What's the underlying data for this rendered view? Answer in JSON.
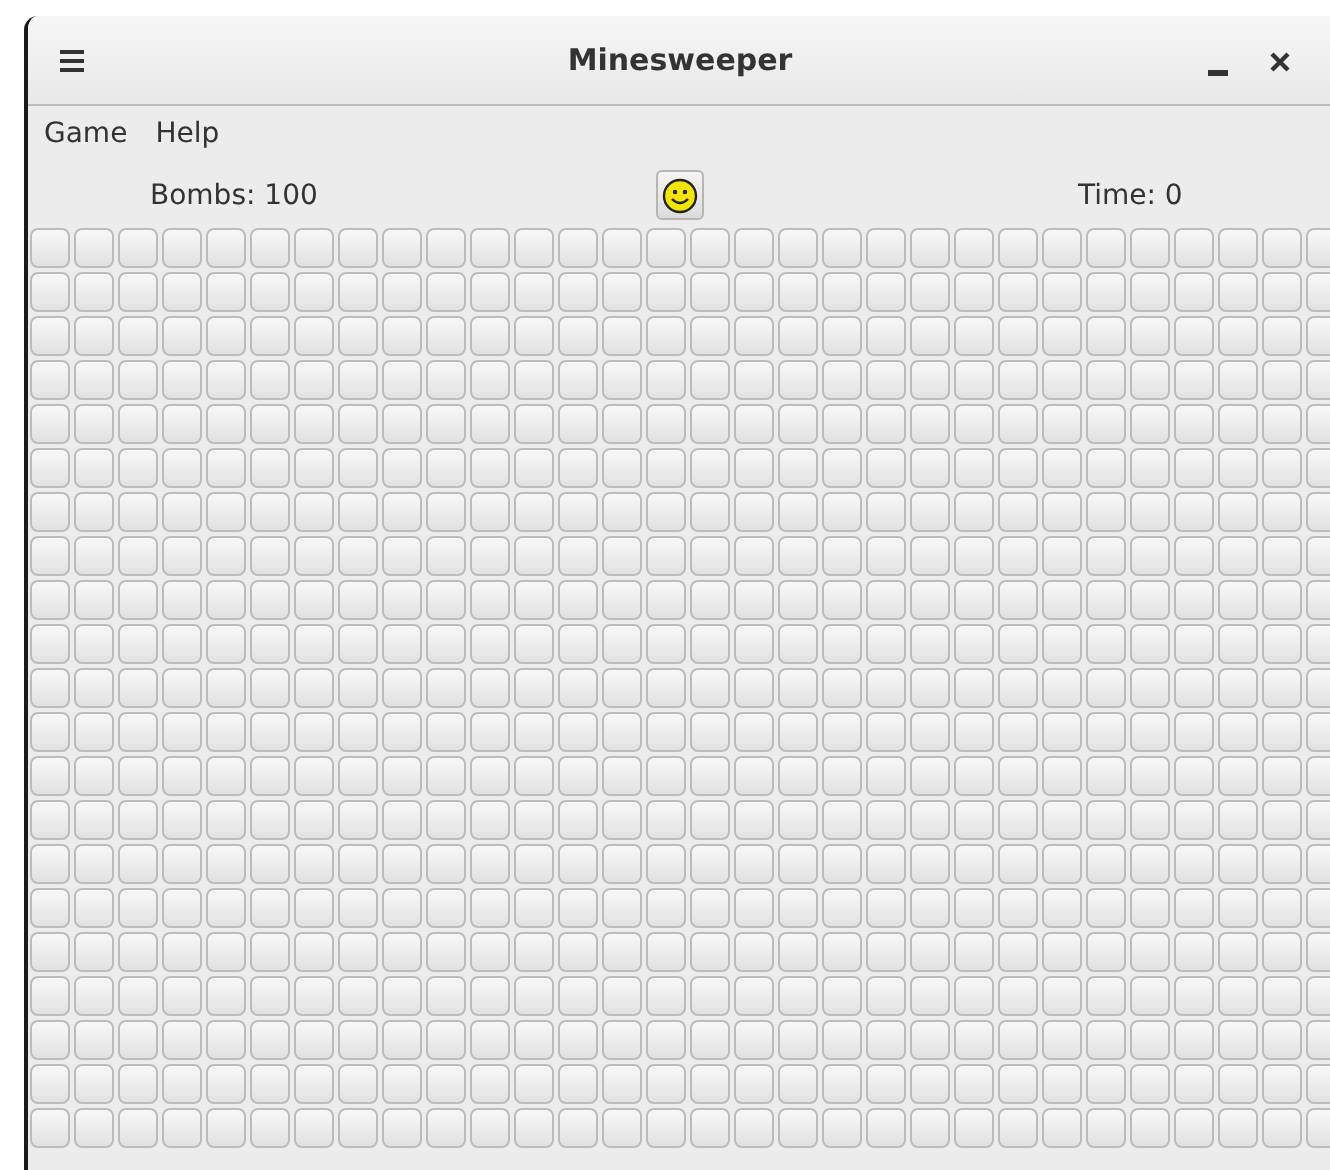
{
  "window": {
    "title": "Minesweeper"
  },
  "menu": [
    "Game",
    "Help"
  ],
  "status": {
    "bombs": "Bombs: 100",
    "time": "Time: 0"
  },
  "board": {
    "rows": [
      [
        false,
        false,
        false,
        false,
        false,
        false,
        false,
        false,
        false,
        false,
        false,
        false,
        false,
        false,
        false,
        false,
        false,
        false,
        false,
        false,
        false,
        false,
        false,
        false,
        false,
        false,
        false,
        false,
        false,
        false
      ],
      [
        false,
        false,
        false,
        false,
        false,
        false,
        false,
        false,
        false,
        false,
        false,
        false,
        false,
        false,
        false,
        false,
        false,
        false,
        false,
        false,
        false,
        false,
        false,
        false,
        false,
        false,
        false,
        false,
        false,
        false
      ],
      [
        false,
        false,
        false,
        false,
        false,
        false,
        false,
        false,
        false,
        false,
        false,
        false,
        false,
        false,
        false,
        false,
        false,
        false,
        false,
        false,
        false,
        false,
        false,
        false,
        false,
        false,
        false,
        false,
        false,
        false
      ],
      [
        false,
        false,
        false,
        false,
        false,
        false,
        false,
        false,
        false,
        false,
        false,
        false,
        false,
        false,
        false,
        false,
        false,
        false,
        false,
        false,
        false,
        false,
        false,
        false,
        false,
        false,
        false,
        false,
        false,
        false
      ],
      [
        false,
        false,
        false,
        false,
        false,
        false,
        false,
        false,
        false,
        false,
        false,
        false,
        false,
        false,
        false,
        false,
        false,
        false,
        false,
        false,
        false,
        false,
        false,
        false,
        false,
        false,
        false,
        false,
        false,
        false
      ],
      [
        false,
        false,
        false,
        false,
        false,
        false,
        false,
        false,
        false,
        false,
        false,
        false,
        false,
        false,
        false,
        false,
        false,
        false,
        false,
        false,
        false,
        false,
        false,
        false,
        false,
        false,
        false,
        false,
        false,
        false
      ],
      [
        false,
        false,
        false,
        false,
        false,
        false,
        false,
        false,
        false,
        false,
        false,
        false,
        false,
        false,
        false,
        false,
        false,
        false,
        false,
        false,
        false,
        false,
        false,
        false,
        false,
        false,
        false,
        false,
        false,
        false
      ],
      [
        false,
        false,
        false,
        false,
        false,
        false,
        false,
        false,
        false,
        false,
        false,
        false,
        false,
        false,
        false,
        false,
        false,
        false,
        false,
        false,
        false,
        false,
        false,
        false,
        false,
        false,
        false,
        false,
        false,
        false
      ],
      [
        false,
        false,
        false,
        false,
        false,
        false,
        false,
        false,
        false,
        false,
        false,
        false,
        false,
        false,
        false,
        false,
        false,
        false,
        false,
        false,
        false,
        false,
        false,
        false,
        false,
        false,
        false,
        false,
        false,
        false
      ],
      [
        false,
        false,
        false,
        false,
        false,
        false,
        false,
        false,
        false,
        false,
        false,
        false,
        false,
        false,
        false,
        false,
        false,
        false,
        false,
        false,
        false,
        false,
        false,
        false,
        false,
        false,
        false,
        false,
        false,
        false
      ],
      [
        false,
        false,
        false,
        false,
        false,
        false,
        false,
        false,
        false,
        false,
        false,
        false,
        false,
        false,
        false,
        false,
        false,
        false,
        false,
        false,
        false,
        false,
        false,
        false,
        false,
        false,
        false,
        false,
        false,
        false
      ],
      [
        false,
        false,
        false,
        false,
        false,
        false,
        false,
        false,
        false,
        false,
        false,
        false,
        false,
        false,
        false,
        false,
        false,
        false,
        false,
        false,
        false,
        false,
        false,
        false,
        false,
        false,
        false,
        false,
        false,
        false
      ],
      [
        false,
        false,
        false,
        false,
        false,
        false,
        false,
        false,
        false,
        false,
        false,
        false,
        false,
        false,
        false,
        false,
        false,
        false,
        false,
        false,
        false,
        false,
        false,
        false,
        false,
        false,
        false,
        false,
        false,
        false
      ],
      [
        false,
        false,
        false,
        false,
        false,
        false,
        false,
        false,
        false,
        false,
        false,
        false,
        false,
        false,
        false,
        false,
        false,
        false,
        false,
        false,
        false,
        false,
        false,
        false,
        false,
        false,
        false,
        false,
        false,
        false
      ],
      [
        false,
        false,
        false,
        false,
        false,
        false,
        false,
        false,
        false,
        false,
        false,
        false,
        false,
        false,
        false,
        false,
        false,
        false,
        false,
        false,
        false,
        false,
        false,
        false,
        false,
        false,
        false,
        false,
        false,
        false
      ],
      [
        false,
        false,
        false,
        false,
        false,
        false,
        false,
        false,
        false,
        false,
        false,
        false,
        false,
        false,
        false,
        false,
        false,
        false,
        false,
        false,
        false,
        false,
        false,
        false,
        false,
        false,
        false,
        false,
        false,
        false
      ],
      [
        false,
        false,
        false,
        false,
        false,
        false,
        false,
        false,
        false,
        false,
        false,
        false,
        false,
        false,
        false,
        false,
        false,
        false,
        false,
        false,
        false,
        false,
        false,
        false,
        false,
        false,
        false,
        false,
        false,
        false
      ],
      [
        false,
        false,
        false,
        false,
        false,
        false,
        false,
        false,
        false,
        false,
        false,
        false,
        false,
        false,
        false,
        false,
        false,
        false,
        false,
        false,
        false,
        false,
        false,
        false,
        false,
        false,
        false,
        false,
        false,
        false
      ],
      [
        false,
        false,
        false,
        false,
        false,
        false,
        false,
        false,
        false,
        false,
        false,
        false,
        false,
        false,
        false,
        false,
        false,
        false,
        false,
        false,
        false,
        false,
        false,
        false,
        false,
        false,
        false,
        false,
        false,
        false
      ],
      [
        false,
        false,
        false,
        false,
        false,
        false,
        false,
        false,
        false,
        false,
        false,
        false,
        false,
        false,
        false,
        false,
        false,
        false,
        false,
        false,
        false,
        false,
        false,
        false,
        false,
        false,
        false,
        false,
        false,
        false
      ],
      [
        false,
        false,
        false,
        false,
        false,
        false,
        false,
        false,
        false,
        false,
        false,
        false,
        false,
        false,
        false,
        false,
        false,
        false,
        false,
        false,
        false,
        false,
        false,
        false,
        false,
        false,
        false,
        false,
        false,
        false
      ]
    ]
  }
}
